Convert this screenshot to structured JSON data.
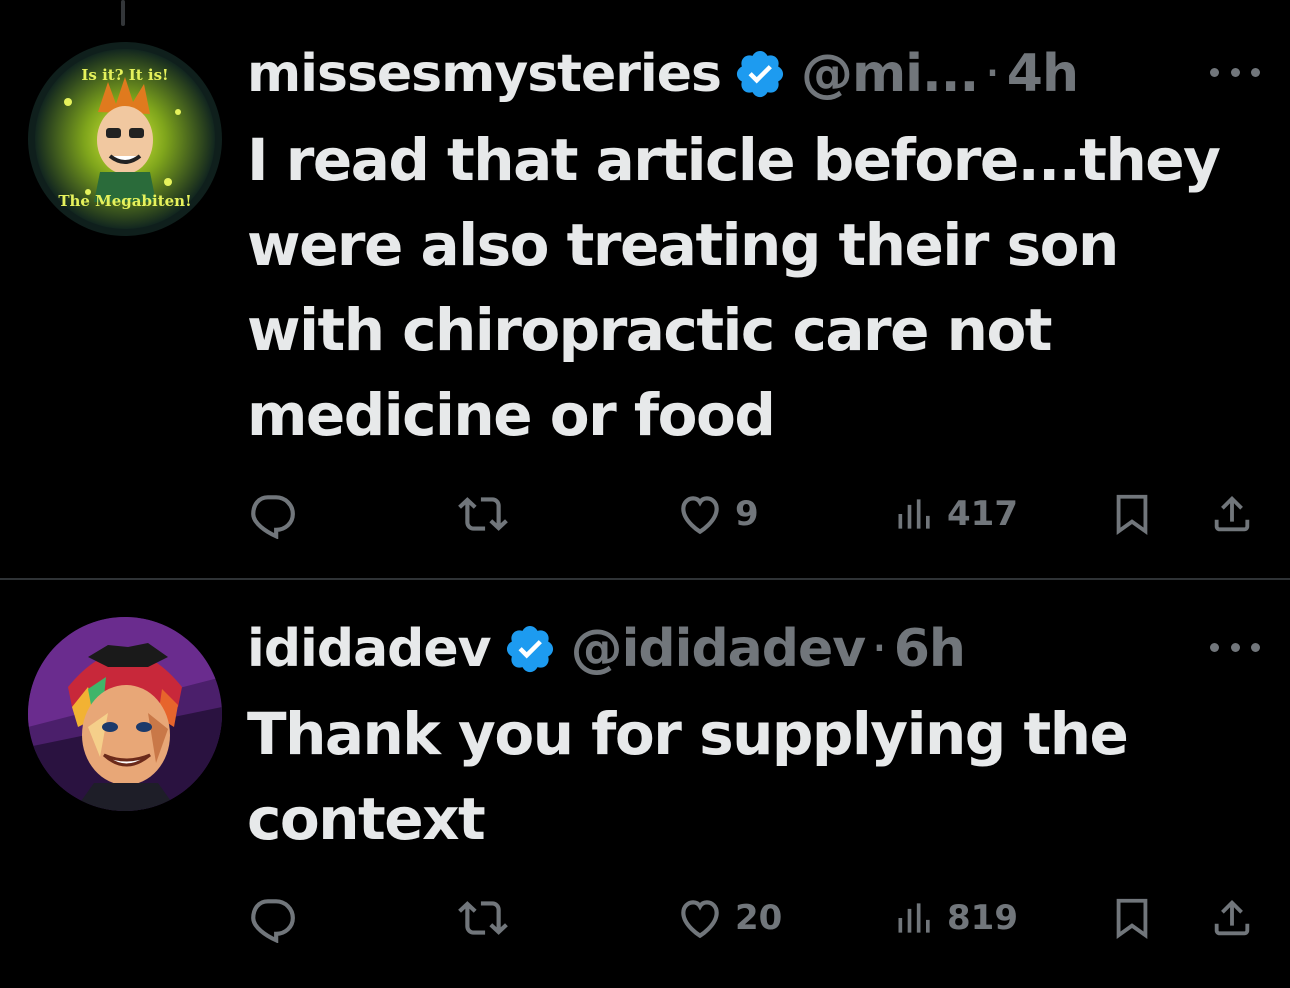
{
  "colors": {
    "background": "#000000",
    "text_primary": "#e7e9ea",
    "text_secondary": "#71767b",
    "verified_blue": "#1d9bf0",
    "divider": "#2f3336"
  },
  "tweets": [
    {
      "avatar": {
        "icon": "avatar-megabiten-icon",
        "top_text": "Is it? It is!",
        "bottom_text": "The Megabiten!"
      },
      "display_name": "missesmysteries",
      "verified_icon": "verified-badge-icon",
      "handle": "@mi...",
      "separator": "·",
      "time": "4h",
      "more_icon": "more-options-icon",
      "text": "I read that article before...they were also treating their son with chiropractic care not medicine or food",
      "actions": {
        "reply_icon": "reply-icon",
        "retweet_icon": "retweet-icon",
        "like_icon": "heart-icon",
        "likes": "9",
        "views_icon": "views-icon",
        "views": "417",
        "bookmark_icon": "bookmark-icon",
        "share_icon": "share-icon"
      }
    },
    {
      "avatar": {
        "icon": "avatar-boy-portrait-icon"
      },
      "display_name": "ididadev",
      "verified_icon": "verified-badge-icon",
      "handle": "@ididadev",
      "separator": "·",
      "time": "6h",
      "more_icon": "more-options-icon",
      "text": "Thank you for supplying the context",
      "actions": {
        "reply_icon": "reply-icon",
        "retweet_icon": "retweet-icon",
        "like_icon": "heart-icon",
        "likes": "20",
        "views_icon": "views-icon",
        "views": "819",
        "bookmark_icon": "bookmark-icon",
        "share_icon": "share-icon"
      }
    }
  ]
}
